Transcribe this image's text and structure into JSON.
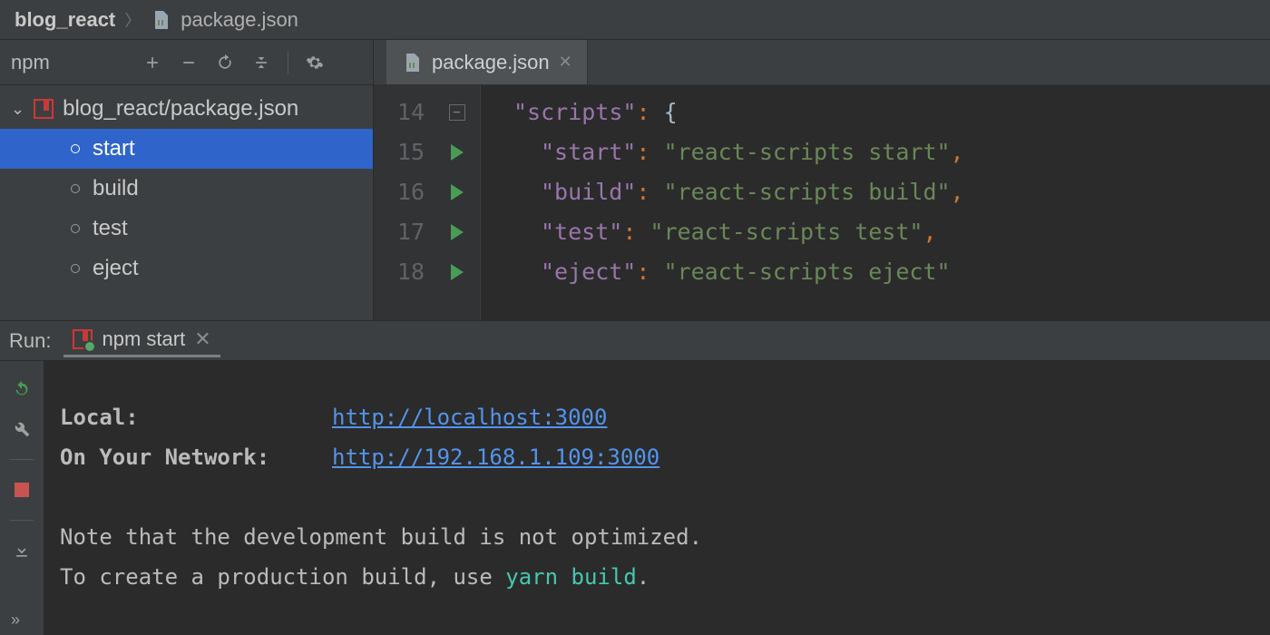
{
  "breadcrumb": {
    "project": "blog_react",
    "file": "package.json"
  },
  "npm_panel": {
    "title": "npm",
    "root_label": "blog_react/package.json",
    "scripts": [
      "start",
      "build",
      "test",
      "eject"
    ],
    "selected": "start"
  },
  "editor": {
    "tab_label": "package.json",
    "lines": [
      {
        "num": 14,
        "run": false,
        "key": "scripts",
        "value": null,
        "open_brace": true
      },
      {
        "num": 15,
        "run": true,
        "key": "start",
        "value": "react-scripts start",
        "comma": true
      },
      {
        "num": 16,
        "run": true,
        "key": "build",
        "value": "react-scripts build",
        "comma": true
      },
      {
        "num": 17,
        "run": true,
        "key": "test",
        "value": "react-scripts test",
        "comma": true
      },
      {
        "num": 18,
        "run": true,
        "key": "eject",
        "value": "react-scripts eject",
        "comma": false
      }
    ]
  },
  "run": {
    "label": "Run:",
    "tab_label": "npm start",
    "local_label": "Local:",
    "network_label": "On Your Network:",
    "local_url": "http://localhost:3000",
    "network_url": "http://192.168.1.109:3000",
    "note_line": "Note that the development build is not optimized.",
    "prod_prefix": "To create a production build, use ",
    "prod_cmd": "yarn build",
    "prod_suffix": "."
  }
}
